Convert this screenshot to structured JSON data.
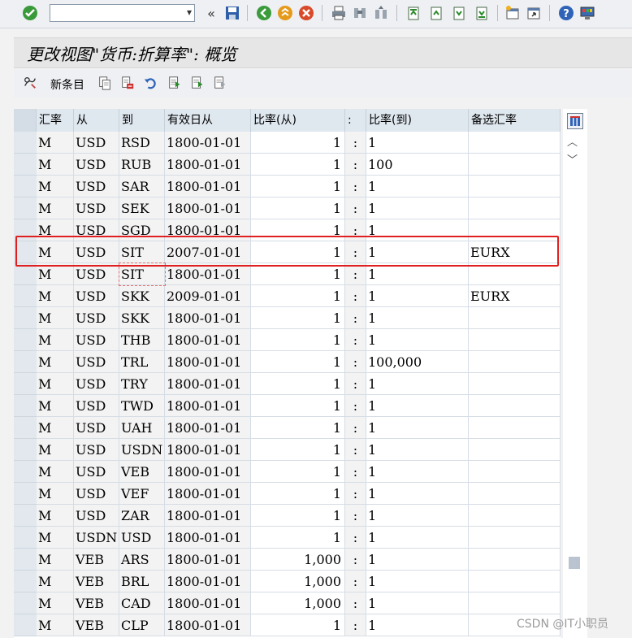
{
  "toolbar": {
    "icons": [
      "enter-icon",
      "back-icon",
      "exit-icon",
      "cancel-icon",
      "print-icon",
      "find-icon",
      "find-next-icon",
      "first-page-icon",
      "previous-page-icon",
      "next-page-icon",
      "last-page-icon",
      "create-session-icon",
      "shortcut-icon",
      "help-icon",
      "customize-layout-icon"
    ],
    "command_value": ""
  },
  "title": "更改视图\"货币:折算率\": 概览",
  "app_toolbar": {
    "new_entries_label": "新条目",
    "icons": [
      "edit-display-icon",
      "copy-as-icon",
      "delete-icon",
      "undo-icon",
      "select-all-icon",
      "select-block-icon",
      "deselect-all-icon"
    ]
  },
  "table": {
    "headers": [
      "汇率",
      "从",
      "到",
      "有效日从",
      "比率(从)",
      ":",
      "比率(到)",
      "备选汇率"
    ],
    "rows": [
      {
        "type": "M",
        "from": "USD",
        "to": "RSD",
        "valid_from": "1800-01-01",
        "ratio_from": "1",
        "sep": ":",
        "ratio_to": "1",
        "alt": ""
      },
      {
        "type": "M",
        "from": "USD",
        "to": "RUB",
        "valid_from": "1800-01-01",
        "ratio_from": "1",
        "sep": ":",
        "ratio_to": "100",
        "alt": ""
      },
      {
        "type": "M",
        "from": "USD",
        "to": "SAR",
        "valid_from": "1800-01-01",
        "ratio_from": "1",
        "sep": ":",
        "ratio_to": "1",
        "alt": ""
      },
      {
        "type": "M",
        "from": "USD",
        "to": "SEK",
        "valid_from": "1800-01-01",
        "ratio_from": "1",
        "sep": ":",
        "ratio_to": "1",
        "alt": ""
      },
      {
        "type": "M",
        "from": "USD",
        "to": "SGD",
        "valid_from": "1800-01-01",
        "ratio_from": "1",
        "sep": ":",
        "ratio_to": "1",
        "alt": ""
      },
      {
        "type": "M",
        "from": "USD",
        "to": "SIT",
        "valid_from": "2007-01-01",
        "ratio_from": "1",
        "sep": ":",
        "ratio_to": "1",
        "alt": "EURX"
      },
      {
        "type": "M",
        "from": "USD",
        "to": "SIT",
        "valid_from": "1800-01-01",
        "ratio_from": "1",
        "sep": ":",
        "ratio_to": "1",
        "alt": ""
      },
      {
        "type": "M",
        "from": "USD",
        "to": "SKK",
        "valid_from": "2009-01-01",
        "ratio_from": "1",
        "sep": ":",
        "ratio_to": "1",
        "alt": "EURX"
      },
      {
        "type": "M",
        "from": "USD",
        "to": "SKK",
        "valid_from": "1800-01-01",
        "ratio_from": "1",
        "sep": ":",
        "ratio_to": "1",
        "alt": ""
      },
      {
        "type": "M",
        "from": "USD",
        "to": "THB",
        "valid_from": "1800-01-01",
        "ratio_from": "1",
        "sep": ":",
        "ratio_to": "1",
        "alt": ""
      },
      {
        "type": "M",
        "from": "USD",
        "to": "TRL",
        "valid_from": "1800-01-01",
        "ratio_from": "1",
        "sep": ":",
        "ratio_to": "100,000",
        "alt": ""
      },
      {
        "type": "M",
        "from": "USD",
        "to": "TRY",
        "valid_from": "1800-01-01",
        "ratio_from": "1",
        "sep": ":",
        "ratio_to": "1",
        "alt": ""
      },
      {
        "type": "M",
        "from": "USD",
        "to": "TWD",
        "valid_from": "1800-01-01",
        "ratio_from": "1",
        "sep": ":",
        "ratio_to": "1",
        "alt": ""
      },
      {
        "type": "M",
        "from": "USD",
        "to": "UAH",
        "valid_from": "1800-01-01",
        "ratio_from": "1",
        "sep": ":",
        "ratio_to": "1",
        "alt": ""
      },
      {
        "type": "M",
        "from": "USD",
        "to": "USDN",
        "valid_from": "1800-01-01",
        "ratio_from": "1",
        "sep": ":",
        "ratio_to": "1",
        "alt": ""
      },
      {
        "type": "M",
        "from": "USD",
        "to": "VEB",
        "valid_from": "1800-01-01",
        "ratio_from": "1",
        "sep": ":",
        "ratio_to": "1",
        "alt": ""
      },
      {
        "type": "M",
        "from": "USD",
        "to": "VEF",
        "valid_from": "1800-01-01",
        "ratio_from": "1",
        "sep": ":",
        "ratio_to": "1",
        "alt": ""
      },
      {
        "type": "M",
        "from": "USD",
        "to": "ZAR",
        "valid_from": "1800-01-01",
        "ratio_from": "1",
        "sep": ":",
        "ratio_to": "1",
        "alt": ""
      },
      {
        "type": "M",
        "from": "USDN",
        "to": "USD",
        "valid_from": "1800-01-01",
        "ratio_from": "1",
        "sep": ":",
        "ratio_to": "1",
        "alt": ""
      },
      {
        "type": "M",
        "from": "VEB",
        "to": "ARS",
        "valid_from": "1800-01-01",
        "ratio_from": "1,000",
        "sep": ":",
        "ratio_to": "1",
        "alt": ""
      },
      {
        "type": "M",
        "from": "VEB",
        "to": "BRL",
        "valid_from": "1800-01-01",
        "ratio_from": "1,000",
        "sep": ":",
        "ratio_to": "1",
        "alt": ""
      },
      {
        "type": "M",
        "from": "VEB",
        "to": "CAD",
        "valid_from": "1800-01-01",
        "ratio_from": "1,000",
        "sep": ":",
        "ratio_to": "1",
        "alt": ""
      },
      {
        "type": "M",
        "from": "VEB",
        "to": "CLP",
        "valid_from": "1800-01-01",
        "ratio_from": "1",
        "sep": ":",
        "ratio_to": "1",
        "alt": ""
      }
    ]
  },
  "watermark": "CSDN @IT小职员",
  "colors": {
    "highlight": "#e02020",
    "header_bg": "#dfe7ef",
    "title_bg": "#e6e6e6"
  }
}
